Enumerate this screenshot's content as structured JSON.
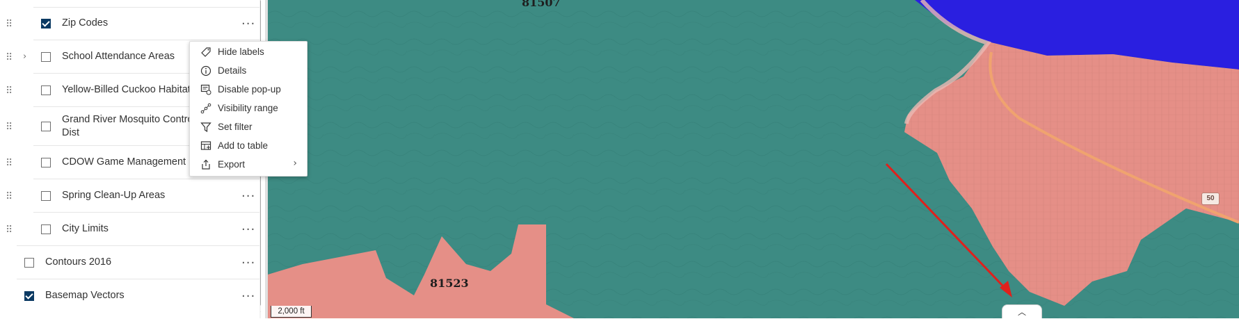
{
  "layers": [
    {
      "label": "Zip Codes",
      "checked": true
    },
    {
      "label": "School Attendance Areas",
      "checked": false,
      "expandable": true
    },
    {
      "label": "Yellow-Billed Cuckoo Habitat",
      "checked": false
    },
    {
      "label": "Grand River Mosquito Control Dist",
      "label_line1": "Grand River Mosquito Control",
      "label_line2": "Dist",
      "checked": false
    },
    {
      "label": "CDOW Game Management Units",
      "checked": false
    },
    {
      "label": "Spring Clean-Up Areas",
      "checked": false
    },
    {
      "label": "City Limits",
      "checked": false
    },
    {
      "label": "Contours 2016",
      "checked": false
    },
    {
      "label": "Basemap Vectors",
      "checked": true
    }
  ],
  "options_icon": "more-horizontal-icon",
  "drag_icon": "drag-handle-icon",
  "context_menu": {
    "items": [
      {
        "label": "Hide labels",
        "icon": "tag-icon"
      },
      {
        "label": "Details",
        "icon": "info-icon"
      },
      {
        "label": "Disable pop-up",
        "icon": "popup-icon"
      },
      {
        "label": "Visibility range",
        "icon": "visibility-range-icon"
      },
      {
        "label": "Set filter",
        "icon": "filter-icon"
      },
      {
        "label": "Add to table",
        "icon": "table-add-icon"
      },
      {
        "label": "Export",
        "icon": "export-icon",
        "submenu": true
      }
    ]
  },
  "map": {
    "zip_labels": [
      "81507",
      "81523"
    ],
    "scale_label": "2,000 ft",
    "highway_shield": "50",
    "colors": {
      "zip_teal": "#3d8b83",
      "zip_salmon": "#e58f87",
      "zip_blue": "#2a1fe0",
      "arrow_red": "#e0201c",
      "checkbox_blue": "#0b3a63"
    }
  }
}
